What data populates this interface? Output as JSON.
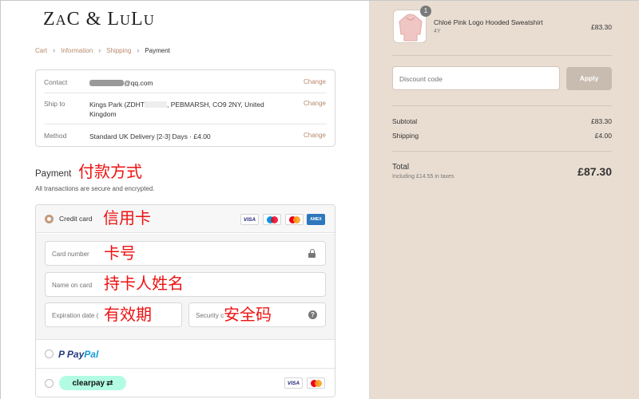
{
  "brand": {
    "logo_a": "Z",
    "logo_b": "A",
    "logo_c": "C & L",
    "logo_d": "U",
    "logo_e": "L",
    "logo_f": "U"
  },
  "breadcrumb": {
    "cart": "Cart",
    "information": "Information",
    "shipping": "Shipping",
    "payment": "Payment"
  },
  "info": {
    "contact_label": "Contact",
    "contact_value": "@qq.com",
    "ship_label": "Ship to",
    "ship_value_a": "Kings Park (ZDHT",
    "ship_value_b": ", PEBMARSH, CO9 2NY, United Kingdom",
    "method_label": "Method",
    "method_value": "Standard UK Delivery [2-3] Days · £4.00",
    "change": "Change"
  },
  "payment": {
    "title": "Payment",
    "subtitle": "All transactions are secure and encrypted.",
    "credit_card_label": "Credit card",
    "card_number_ph": "Card number",
    "name_ph": "Name on card",
    "expiry_ph": "Expiration date (",
    "security_ph": "Security c",
    "paypal_a": "Pay",
    "paypal_b": "Pal",
    "clearpay": "clearpay",
    "visa": "VISA",
    "amex": "AMEX"
  },
  "annotations": {
    "payment_method": "付款方式",
    "credit_card": "信用卡",
    "card_number": "卡号",
    "cardholder": "持卡人姓名",
    "expiry": "有效期",
    "security": "安全码"
  },
  "summary": {
    "qty": "1",
    "product_name": "Chloé Pink Logo Hooded Sweatshirt",
    "variant": "4Y",
    "price": "£83.30",
    "discount_ph": "Discount code",
    "apply": "Apply",
    "subtotal_label": "Subtotal",
    "subtotal_value": "£83.30",
    "shipping_label": "Shipping",
    "shipping_value": "£4.00",
    "total_label": "Total",
    "tax_note": "Including £14.55 in taxes",
    "total_value": "£87.30"
  },
  "colors": {
    "accent": "#b8896a",
    "sidebar_bg": "#e9ddd2",
    "annotation_red": "#ee1111"
  }
}
